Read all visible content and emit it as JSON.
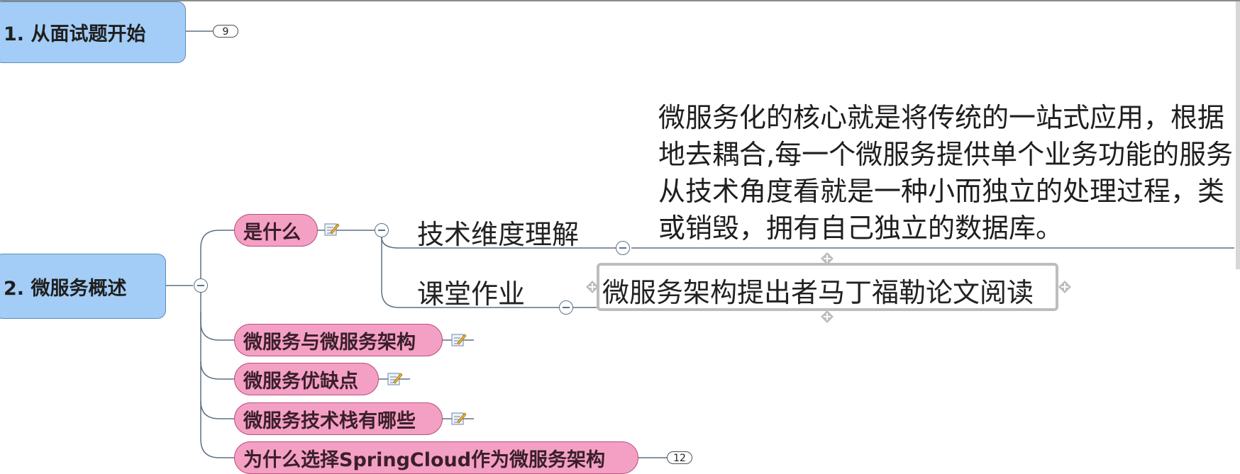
{
  "topics": {
    "t1": {
      "label": "1. 从面试题开始",
      "collapsed_count": "9"
    },
    "t2": {
      "label": "2. 微服务概述"
    }
  },
  "subtopics": {
    "what": {
      "label": "是什么"
    },
    "vs": {
      "label": "微服务与微服务架构"
    },
    "pros_cons": {
      "label": "微服务优缺点"
    },
    "stack": {
      "label": "微服务技术栈有哪些"
    },
    "why_sc": {
      "label": "为什么选择SpringCloud作为微服务架构",
      "collapsed_count": "12"
    }
  },
  "what_children": {
    "tech": {
      "label": "技术维度理解"
    },
    "homework": {
      "label": "课堂作业"
    }
  },
  "tech_paragraph": [
    "微服务化的核心就是将传统的一站式应用，根据",
    "地去耦合,每一个微服务提供单个业务功能的服务",
    "从技术角度看就是一种小而独立的处理过程，类",
    "或销毁，拥有自己独立的数据库。"
  ],
  "homework_child": {
    "label": "微服务架构提出者马丁福勒论文阅读"
  },
  "colors": {
    "main_topic_fill": "#a3cdf6",
    "subtopic_fill": "#f4a0c4",
    "connector": "#5d7184",
    "selection": "#bdbdbd"
  },
  "icons": {
    "note": "note-pencil-icon",
    "collapse": "collapse-minus-icon",
    "handle": "resize-handle-icon"
  }
}
